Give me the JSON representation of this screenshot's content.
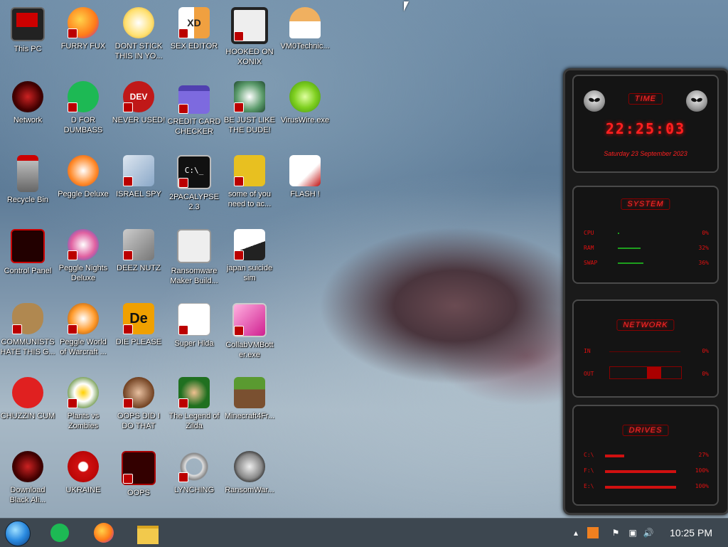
{
  "desktop": {
    "icons": [
      {
        "label": "This PC"
      },
      {
        "label": "FURRY FUX"
      },
      {
        "label": "DONT STICK THIS IN YO..."
      },
      {
        "label": "SEX EDITOR"
      },
      {
        "label": "HOOKED ON XONIX"
      },
      {
        "label": "VM0Technic..."
      },
      {
        "label": "Network"
      },
      {
        "label": "D FOR DUMBASS"
      },
      {
        "label": "NEVER USED!"
      },
      {
        "label": "CREDIT CARD CHECKER"
      },
      {
        "label": "BE JUST LIKE THE DUDE!"
      },
      {
        "label": "VirusWire.exe"
      },
      {
        "label": "Recycle Bin"
      },
      {
        "label": "Peggle Deluxe"
      },
      {
        "label": "ISRAEL SPY"
      },
      {
        "label": "2PACALYPSE 2.3"
      },
      {
        "label": "some of you need to ac..."
      },
      {
        "label": "FLASH !"
      },
      {
        "label": "Control Panel"
      },
      {
        "label": "Peggle Nights Deluxe"
      },
      {
        "label": "DEEZ NUTZ"
      },
      {
        "label": "Ransomware Maker Build..."
      },
      {
        "label": "japan suicide sim"
      },
      {
        "label": "COMMUNISTS HATE THIS G..."
      },
      {
        "label": "Peggle World of Warcraft ..."
      },
      {
        "label": "DIE PLEASE"
      },
      {
        "label": "Super Hlda"
      },
      {
        "label": "CollabVMBott er.exe"
      },
      {
        "label": "CHUZZIN CUM"
      },
      {
        "label": "Plants vs Zombies"
      },
      {
        "label": "OOPS DID I DO THAT"
      },
      {
        "label": "The Legend of Zilda"
      },
      {
        "label": "Minecraft4Fr..."
      },
      {
        "label": "Download Black Ali..."
      },
      {
        "label": "UKRAINE"
      },
      {
        "label": "OOPS"
      },
      {
        "label": "LYNCHING"
      },
      {
        "label": "RansomWar..."
      }
    ]
  },
  "widget": {
    "time_title": "TIME",
    "time": "22:25:03",
    "date": "Saturday 23 September 2023",
    "system_title": "SYSTEM",
    "cpu_label": "CPU",
    "cpu_value": "0%",
    "cpu_level": 0,
    "ram_label": "RAM",
    "ram_value": "32%",
    "ram_level": 32,
    "swap_label": "SWAP",
    "swap_value": "36%",
    "swap_level": 36,
    "network_title": "NETWORK",
    "in_label": "IN",
    "in_value": "0%",
    "out_label": "OUT",
    "out_value": "0%",
    "drives_title": "DRIVES",
    "drive_c_label": "C:\\",
    "drive_c_value": "27%",
    "drive_c_level": 27,
    "drive_f_label": "F:\\",
    "drive_f_value": "100%",
    "drive_f_level": 100,
    "drive_e_label": "E:\\",
    "drive_e_value": "100%",
    "drive_e_level": 100
  },
  "taskbar": {
    "clock": "10:25 PM",
    "apps": [
      "start-orb-icon",
      "notes-app-icon",
      "firefox-icon",
      "file-explorer-icon"
    ]
  },
  "colors": {
    "widget_red": "#ff2020",
    "taskbar_bg": "#3d4750"
  }
}
